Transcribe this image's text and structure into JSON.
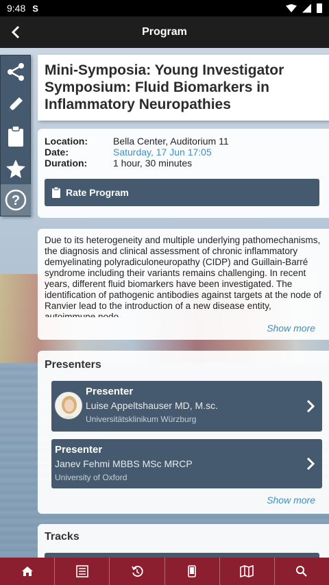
{
  "status_bar": {
    "time": "9:48",
    "app_icon": "S"
  },
  "app_bar": {
    "title": "Program",
    "back_icon": "chevron-left-icon"
  },
  "sidebar": {
    "items": [
      {
        "name": "share-icon"
      },
      {
        "name": "pencil-icon"
      },
      {
        "name": "clipboard-icon"
      },
      {
        "name": "star-icon"
      },
      {
        "name": "help-icon"
      }
    ]
  },
  "session": {
    "title": "Mini-Symposia: Young Investigator Symposium: Fluid Biomarkers in Inflammatory Neuropathies",
    "location_label": "Location:",
    "location": "Bella Center, Auditorium 11",
    "date_label": "Date:",
    "date": "Saturday, 17 Jun 17:05",
    "duration_label": "Duration:",
    "duration": "1 hour, 30 minutes",
    "rate_button": "Rate Program",
    "description": "Due to its heterogeneity and multiple underlying pathomechanisms, the diagnosis and clinical assessment of chronic inflammatory demyelinating polyradiculoneuropathy (CIDP) and Guillain-Barré syndrome including their variants remains challenging. In recent years, different fluid biomarkers have been investigated. The identification of pathogenic antibodies against targets at the node of Ranvier lead to the introduction of a new disease entity, autoimmune nodo-",
    "show_more": "Show more"
  },
  "presenters": {
    "heading": "Presenters",
    "items": [
      {
        "role": "Presenter",
        "name": "Luise Appeltshauser MD, M.sc.",
        "institution": "Universitätsklinikum Würzburg"
      },
      {
        "role": "Presenter",
        "name": "Janev Fehmi MBBS MSc MRCP",
        "institution": "University of Oxford"
      }
    ],
    "show_more": "Show more"
  },
  "tracks": {
    "heading": "Tracks"
  },
  "bottom_bar": {
    "items": [
      {
        "name": "home-icon"
      },
      {
        "name": "agenda-icon"
      },
      {
        "name": "history-icon"
      },
      {
        "name": "mobile-icon"
      },
      {
        "name": "map-icon"
      },
      {
        "name": "search-icon"
      }
    ]
  },
  "colors": {
    "accent": "#455a6e",
    "link": "#3d8fbf",
    "bottom_bar": "#8c1f2f",
    "app_bar": "#1e1e1e"
  }
}
